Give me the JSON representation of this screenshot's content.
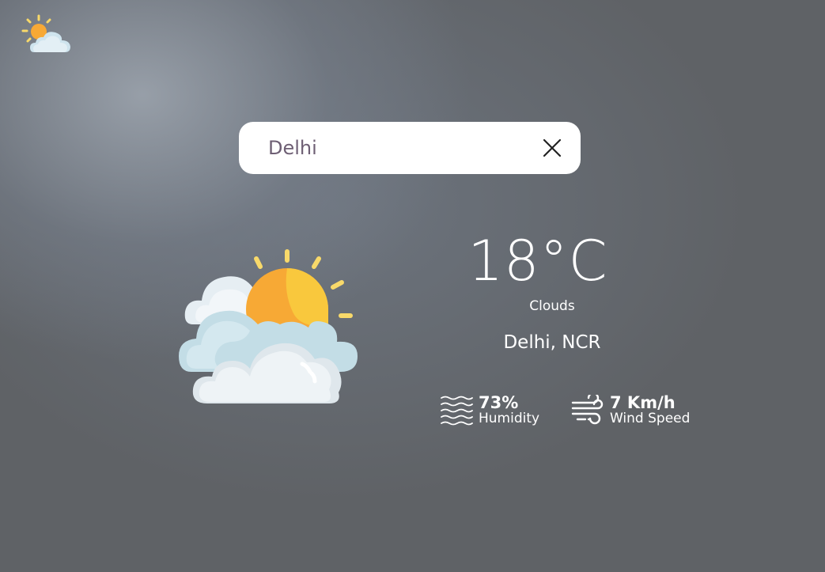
{
  "header": {
    "logo_icon": "partly-cloudy-icon"
  },
  "search": {
    "value": "Delhi",
    "clear_icon": "close-icon"
  },
  "weather": {
    "illustration_icon": "sun-behind-clouds-icon",
    "temperature": "18°C",
    "condition": "Clouds",
    "location": "Delhi, NCR"
  },
  "stats": {
    "humidity": {
      "icon": "humidity-waves-icon",
      "value": "73%",
      "label": "Humidity"
    },
    "wind": {
      "icon": "wind-icon",
      "value": "7 Km/h",
      "label": "Wind Speed"
    }
  },
  "colors": {
    "sun": "#f9c83d",
    "sun_shade": "#f7a935",
    "ray": "#f8d96a",
    "cloud_light": "#eef2f5",
    "cloud_blue": "#c3dde6",
    "search_text": "#6e5f74"
  }
}
